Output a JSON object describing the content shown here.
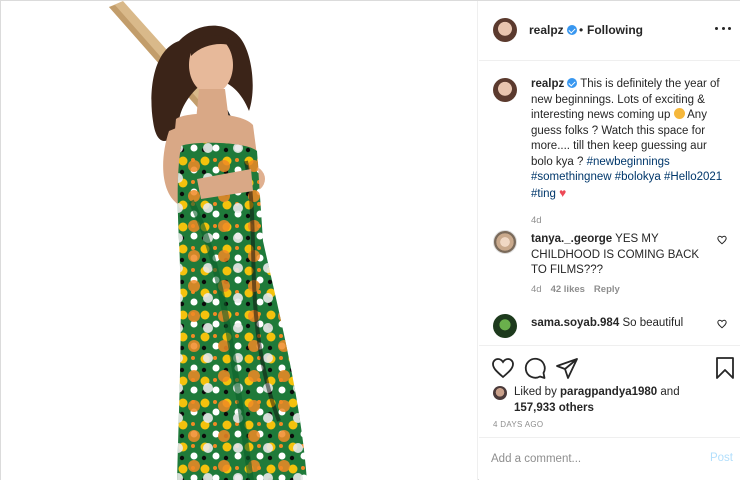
{
  "post": {
    "photo_alt": "Woman in a green patterned dress holding a cricket bat over her shoulder"
  },
  "header": {
    "username": "realpz",
    "separator": "•",
    "follow_state": "Following",
    "more_icon": "more-horizontal-icon",
    "verified_icon": "verified-badge-icon"
  },
  "caption": {
    "username": "realpz",
    "text_part1": " This is definitely the year of new beginnings. Lots of exciting & interesting news coming up ",
    "text_part2": " Any guess folks ? Watch this space for more.... till then keep guessing aur bolo kya ? ",
    "hashtags": [
      "#newbeginnings",
      "#somethingnew",
      "#bolokya",
      "#Hello2021",
      "#ting"
    ],
    "time": "4d"
  },
  "comments": [
    {
      "username": "tanya._.george",
      "text": "YES MY CHILDHOOD IS COMING BACK TO FILMS???",
      "time": "4d",
      "likes": "42 likes",
      "reply": "Reply"
    },
    {
      "username": "sama.soyab.984",
      "text": "So beautiful"
    }
  ],
  "actions": {
    "like_icon": "heart-outline-icon",
    "comment_icon": "comment-icon",
    "share_icon": "paper-plane-icon",
    "save_icon": "bookmark-icon"
  },
  "likes": {
    "prefix": "Liked by ",
    "first_liker": "paragpandya1980",
    "middle": " and ",
    "others_count": "157,933 others"
  },
  "post_time": "4 DAYS AGO",
  "add_comment": {
    "placeholder": "Add a comment...",
    "post_label": "Post"
  },
  "colors": {
    "link": "#00376b",
    "verified": "#3897f0",
    "muted": "#8e8e8e",
    "post_disabled": "#b2dffc",
    "heart": "#ed4956"
  }
}
